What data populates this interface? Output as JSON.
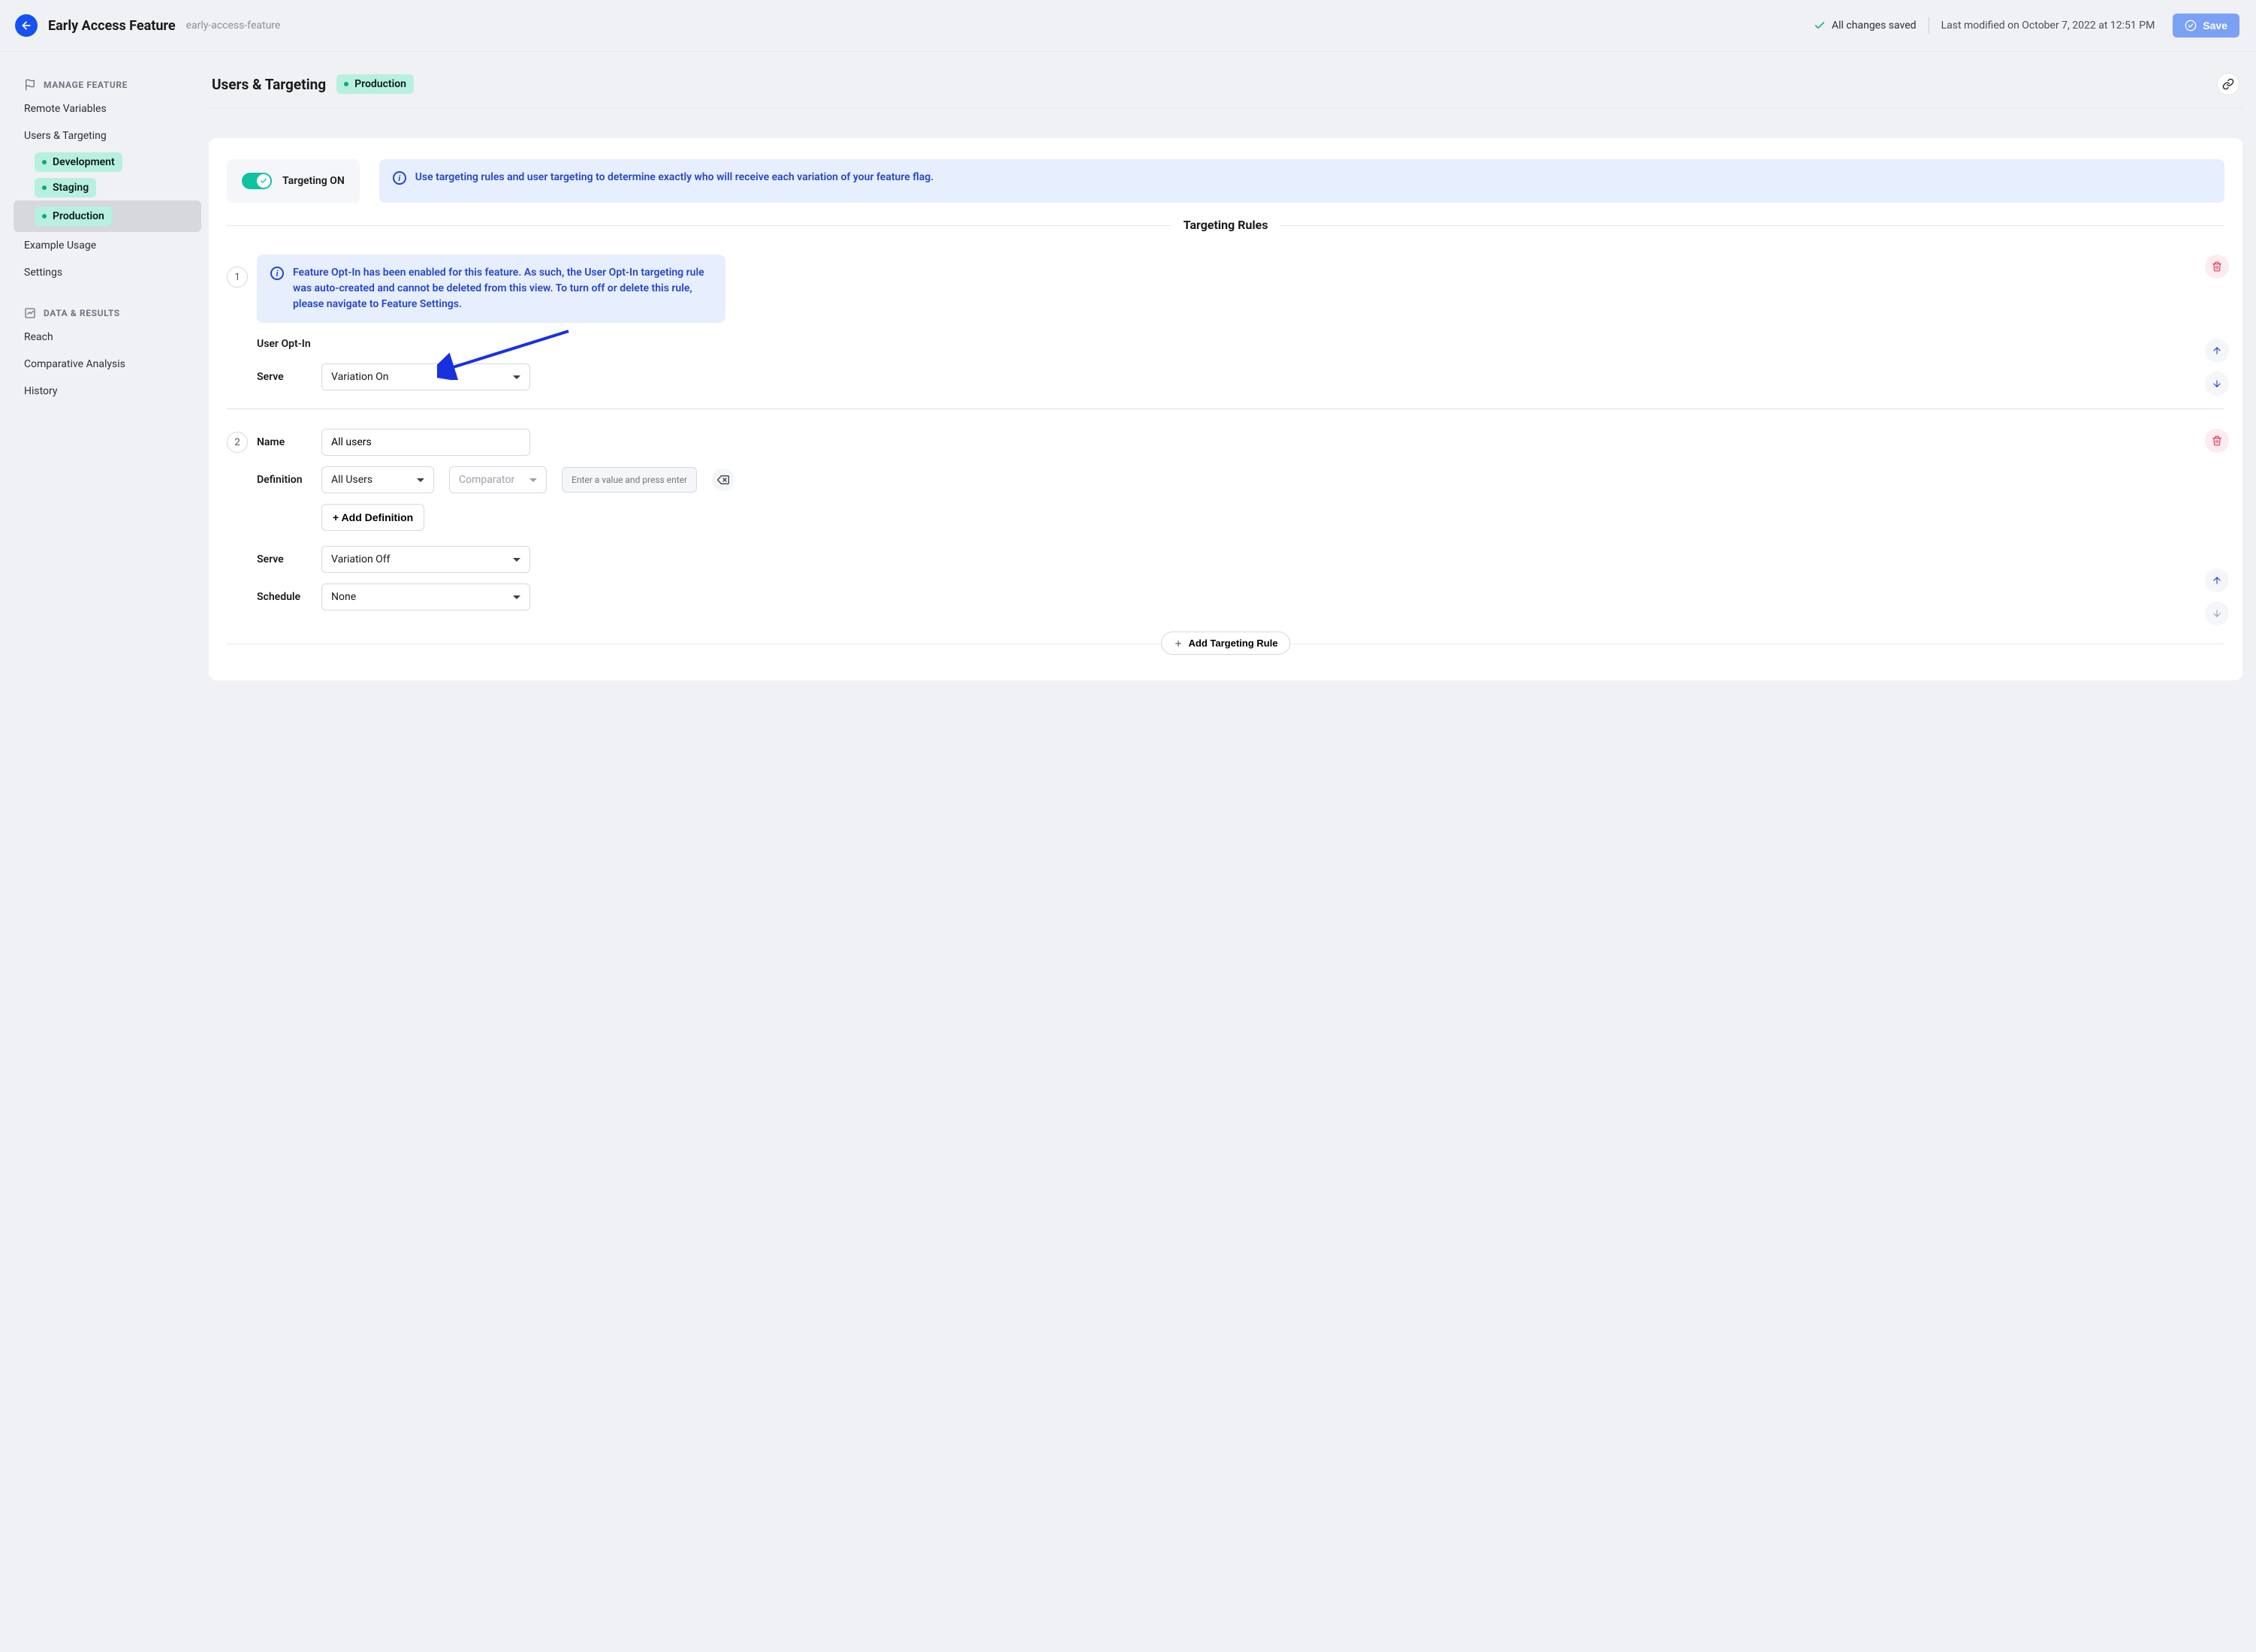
{
  "topbar": {
    "feature_title": "Early Access Feature",
    "feature_slug": "early-access-feature",
    "saved_text": "All changes saved",
    "last_modified": "Last modified on October 7, 2022 at 12:51 PM",
    "save_label": "Save"
  },
  "sidebar": {
    "manage_header": "Manage Feature",
    "data_header": "Data & Results",
    "items": {
      "remote_vars": "Remote Variables",
      "users_targeting": "Users & Targeting",
      "example_usage": "Example Usage",
      "settings": "Settings",
      "reach": "Reach",
      "comparative": "Comparative Analysis",
      "history": "History"
    },
    "envs": {
      "development": "Development",
      "staging": "Staging",
      "production": "Production"
    }
  },
  "content": {
    "title": "Users & Targeting",
    "env_badge": "Production",
    "toggle_label": "Targeting ON",
    "banner_msg": "Use targeting rules and user targeting to determine exactly who will receive each variation of your feature flag.",
    "rules_header": "Targeting Rules",
    "add_rule_label": "Add Targeting Rule"
  },
  "rule1": {
    "number": "1",
    "banner_msg": "Feature Opt-In has been enabled for this feature. As such, the User Opt-In targeting rule was auto-created and cannot be deleted from this view. To turn off or delete this rule, please navigate to Feature Settings.",
    "title": "User Opt-In",
    "serve_label": "Serve",
    "serve_value": "Variation On"
  },
  "rule2": {
    "number": "2",
    "name_label": "Name",
    "name_value": "All users",
    "def_label": "Definition",
    "def_filter": "All Users",
    "comparator_placeholder": "Comparator",
    "value_placeholder": "Enter a value and press enter...",
    "add_def_label": "+ Add Definition",
    "serve_label": "Serve",
    "serve_value": "Variation Off",
    "schedule_label": "Schedule",
    "schedule_value": "None"
  }
}
